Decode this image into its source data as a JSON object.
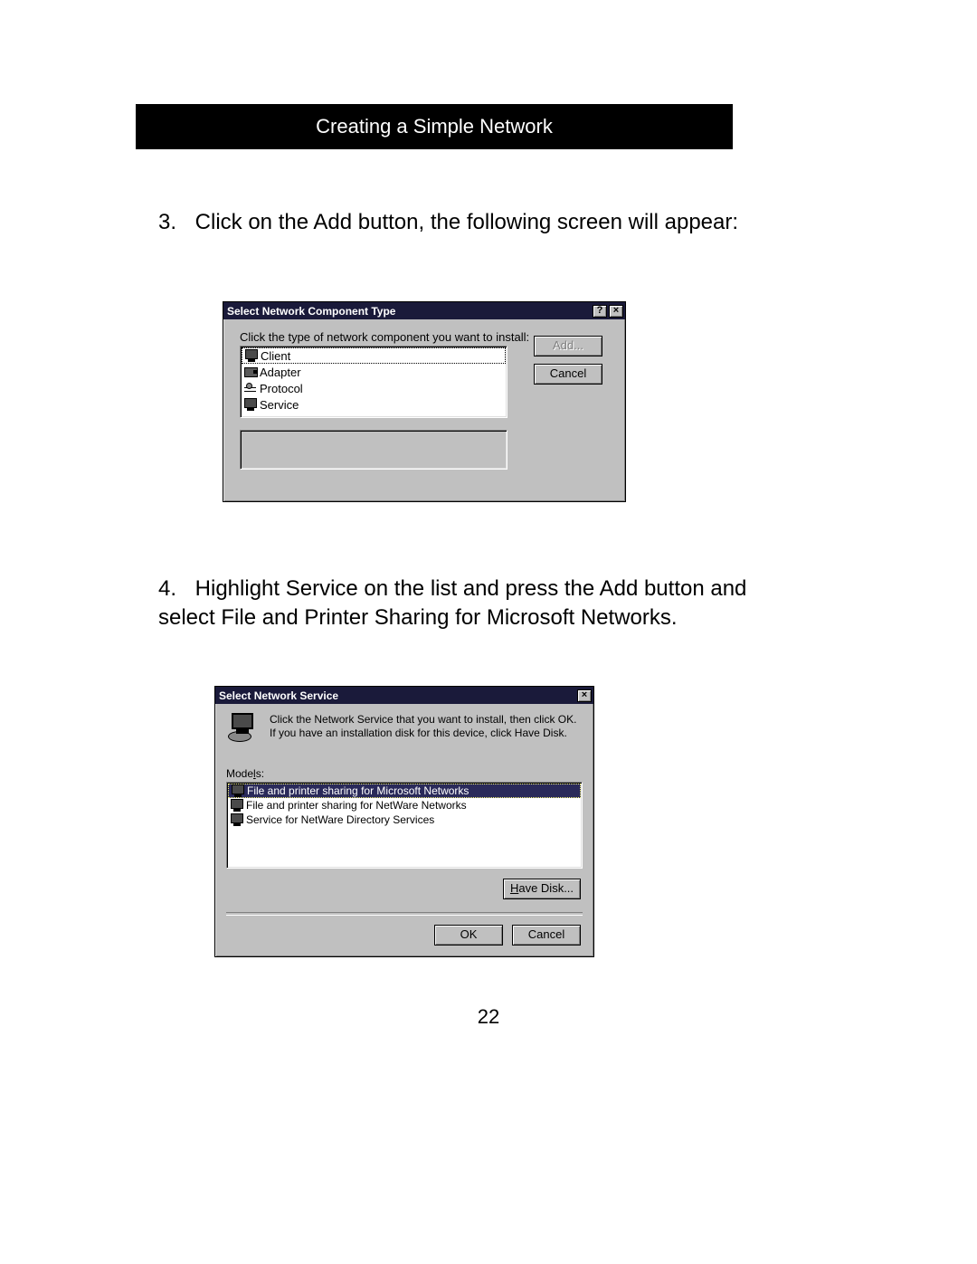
{
  "header": {
    "title": "Creating a Simple Network"
  },
  "steps": {
    "step3": {
      "num": "3.",
      "text": "Click on the Add button, the following screen will appear:"
    },
    "step4": {
      "num": "4.",
      "text": "Highlight Service on the list and press the Add button and select File and Printer Sharing for Microsoft Networks."
    }
  },
  "dialog1": {
    "title": "Select Network Component Type",
    "help_btn": "?",
    "close_btn": "×",
    "instruction": "Click the type of network component you want to install:",
    "items": [
      {
        "label": "Client",
        "icon": "monitor",
        "selected": true
      },
      {
        "label": "Adapter",
        "icon": "card",
        "selected": false
      },
      {
        "label": "Protocol",
        "icon": "protocol",
        "selected": false
      },
      {
        "label": "Service",
        "icon": "monitor",
        "selected": false
      }
    ],
    "add_btn": "Add...",
    "cancel_btn": "Cancel"
  },
  "dialog2": {
    "title": "Select Network Service",
    "close_btn": "×",
    "instruction": "Click the Network Service that you want to install, then click OK. If you have an installation disk for this device, click Have Disk.",
    "models_label_pre": "Mode",
    "models_label_ul": "l",
    "models_label_post": "s:",
    "models": [
      {
        "label": "File and printer sharing for Microsoft Networks",
        "selected": true
      },
      {
        "label": "File and printer sharing for NetWare Networks",
        "selected": false
      },
      {
        "label": "Service for NetWare Directory Services",
        "selected": false
      }
    ],
    "have_disk_btn_pre": "",
    "have_disk_btn": "Have Disk...",
    "ok_btn": "OK",
    "cancel_btn": "Cancel"
  },
  "page_number": "22"
}
